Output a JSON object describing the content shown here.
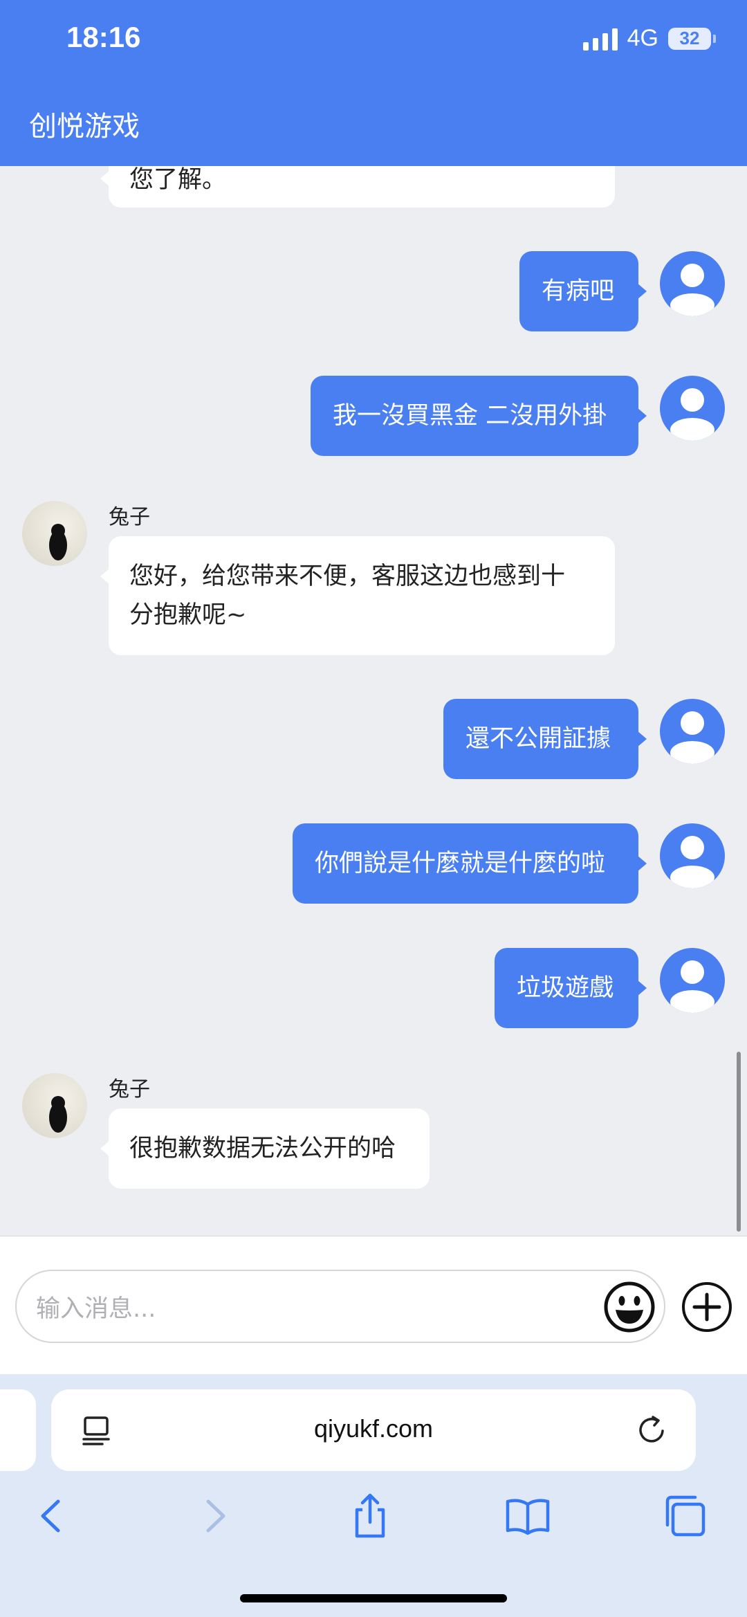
{
  "status": {
    "time": "18:16",
    "network": "4G",
    "battery": "32"
  },
  "app": {
    "title": "创悦游戏"
  },
  "messages": {
    "partial_agent": "您了解。",
    "m1": "有病吧",
    "m2": "我一沒買黑金 二沒用外掛",
    "agent1_name": "兔子",
    "agent1_line1": "您好，给您带来不便，客服这边也感到十",
    "agent1_line2": "分抱歉呢~",
    "m3": "還不公開証據",
    "m4": "你們說是什麼就是什麼的啦",
    "m5": "垃圾遊戲",
    "agent2_name": "兔子",
    "agent2_text": "很抱歉数据无法公开的哈"
  },
  "composer": {
    "placeholder": "输入消息..."
  },
  "browser": {
    "url": "qiyukf.com"
  },
  "colors": {
    "accent": "#4a7ff2",
    "chat_bg": "#edeef2"
  }
}
